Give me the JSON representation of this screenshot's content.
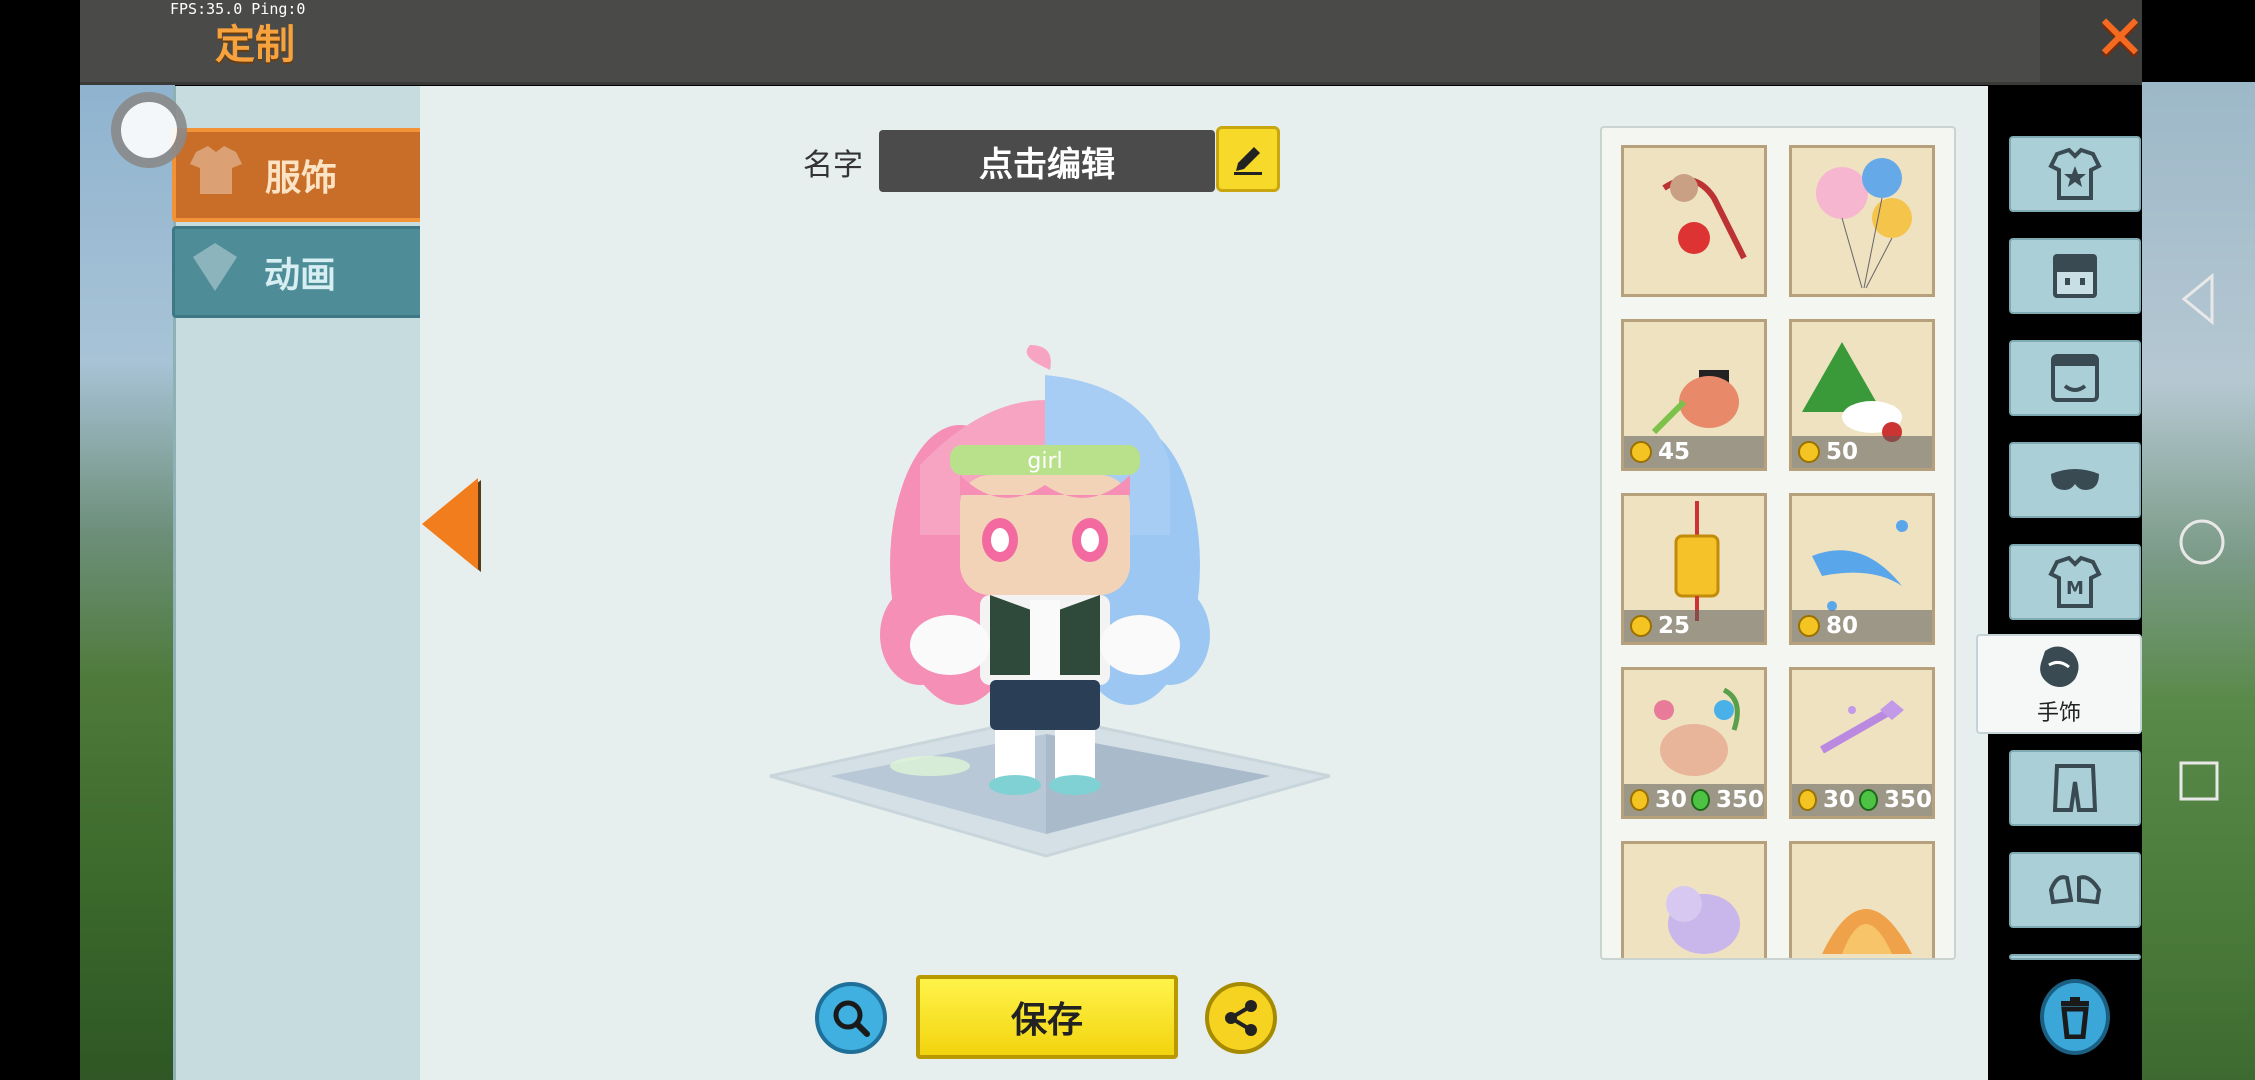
{
  "debug": {
    "fps_text": "FPS:35.0  Ping:0"
  },
  "header": {
    "title": "定制"
  },
  "sidebar": {
    "tabs": [
      {
        "label": "服饰"
      },
      {
        "label": "动画"
      }
    ]
  },
  "name": {
    "label": "名字",
    "value": "点击编辑"
  },
  "buttons": {
    "save_label": "保存"
  },
  "items": [
    {
      "price": null,
      "gem": null
    },
    {
      "price": null,
      "gem": null
    },
    {
      "price": "45",
      "gem": null
    },
    {
      "price": "50",
      "gem": null
    },
    {
      "price": "25",
      "gem": null
    },
    {
      "price": "80",
      "gem": null
    },
    {
      "price": "30",
      "gem": "350"
    },
    {
      "price": "30",
      "gem": "350"
    },
    {
      "price": null,
      "gem": null
    },
    {
      "price": null,
      "gem": null
    }
  ],
  "categories": {
    "selected_label": "手饰"
  },
  "colors": {
    "accent_orange": "#f27d1c",
    "save_yellow": "#f7d92a",
    "panel_bg": "#e6efee"
  }
}
